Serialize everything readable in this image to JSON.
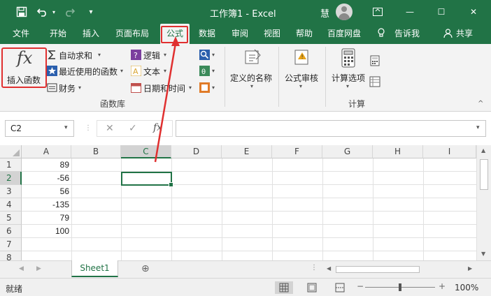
{
  "window": {
    "title": "工作簿1  -  Excel",
    "user": "慧",
    "minimize": "—",
    "maximize": "☐",
    "close": "✕"
  },
  "qat": {
    "save_icon": "save-icon",
    "undo_icon": "undo-icon",
    "redo_icon": "redo-icon",
    "customize_icon": "customize-icon"
  },
  "tabs": [
    "文件",
    "开始",
    "插入",
    "页面布局",
    "公式",
    "数据",
    "审阅",
    "视图",
    "帮助",
    "百度网盘",
    "告诉我",
    "共享"
  ],
  "active_tab": "公式",
  "ribbon": {
    "insert_function": {
      "icon": "fx",
      "label": "插入函数"
    },
    "autosum": "自动求和",
    "recent": "最近使用的函数",
    "finance": "财务",
    "logic": "逻辑",
    "text": "文本",
    "datetime": "日期和时间",
    "group_function_library": "函数库",
    "defined_names": "定义的名称",
    "formula_auditing": "公式审核",
    "calc_options": "计算选项",
    "group_calc": "计算"
  },
  "formula_bar": {
    "name_box": "C2",
    "fx_label": "fx",
    "value": ""
  },
  "columns": [
    "A",
    "B",
    "C",
    "D",
    "E",
    "F",
    "G",
    "H",
    "I"
  ],
  "rows": [
    "1",
    "2",
    "3",
    "4",
    "5",
    "6",
    "7",
    "8"
  ],
  "cells": {
    "A1": "89",
    "A2": "-56",
    "A3": "56",
    "A4": "-135",
    "A5": "79",
    "A6": "100"
  },
  "selected_cell": "C2",
  "sheets": [
    "Sheet1"
  ],
  "status": {
    "ready": "就绪",
    "zoom": "100%"
  },
  "colors": {
    "accent": "#217346",
    "annotation": "#e03030"
  }
}
